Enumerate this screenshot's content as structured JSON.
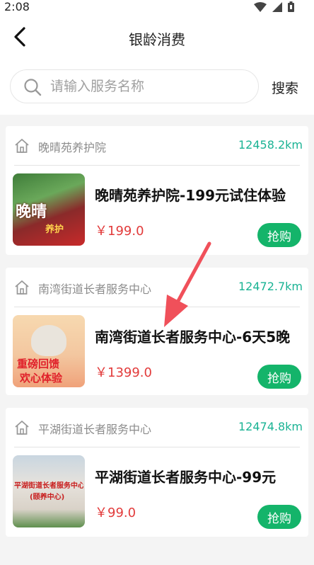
{
  "status": {
    "time": "2:08"
  },
  "header": {
    "title": "银龄消费"
  },
  "search": {
    "placeholder": "请输入服务名称",
    "button_label": "搜索"
  },
  "buy_label": "抢购",
  "items": [
    {
      "org": "晚晴苑养护院",
      "distance": "12458.2km",
      "name": "晚晴苑养护院-199元试住体验",
      "price": "￥199.0",
      "thumb_text": "晚晴",
      "thumb_sub": "养护"
    },
    {
      "org": "南湾街道长者服务中心",
      "distance": "12472.7km",
      "name": "南湾街道长者服务中心-6天5晚",
      "price": "￥1399.0",
      "thumb_text": "重磅回馈",
      "thumb_sub": "欢心体验"
    },
    {
      "org": "平湖街道长者服务中心",
      "distance": "12474.8km",
      "name": "平湖街道长者服务中心-99元",
      "price": "￥99.0",
      "thumb_text": "平湖街道长者服务中心",
      "thumb_sub": "(颐养中心)"
    }
  ],
  "colors": {
    "accent": "#1ab394",
    "buy": "#14b46a",
    "price": "#e23b3b",
    "arrow": "#f0505a"
  }
}
